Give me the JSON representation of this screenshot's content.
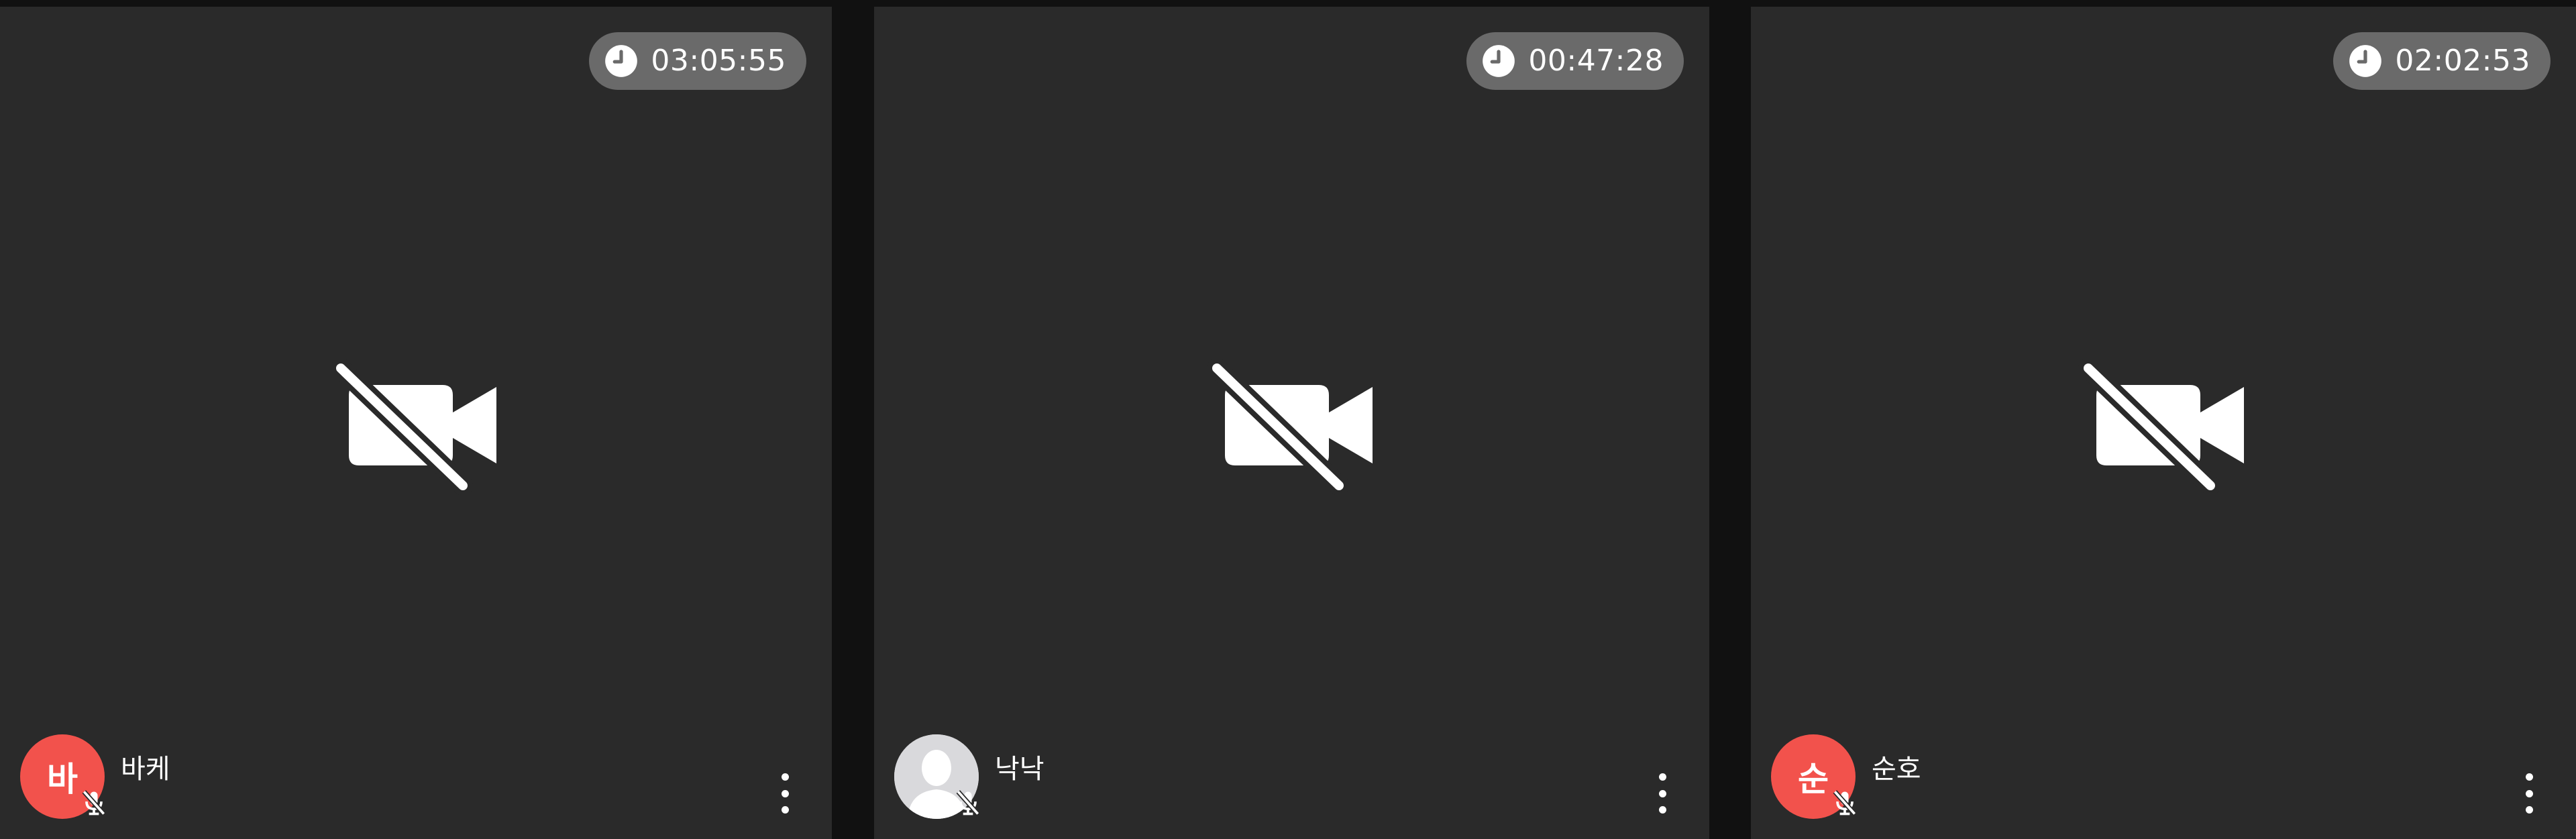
{
  "colors": {
    "page_background": "#111111",
    "tile_background": "#2a2a2a",
    "timer_pill": "#6a6a6a",
    "initials_avatar": "#f2524c",
    "photo_avatar": "#e4e4e6",
    "icon": "#ffffff"
  },
  "tiles": [
    {
      "timer": "03:05:55",
      "video_state_icon": "video-off-icon",
      "avatar": {
        "type": "initial",
        "initial": "바"
      },
      "name": "바케",
      "mic_state_icon": "mic-off-icon",
      "menu_icon": "more-vertical-icon"
    },
    {
      "timer": "00:47:28",
      "video_state_icon": "video-off-icon",
      "avatar": {
        "type": "default-photo",
        "initial": ""
      },
      "name": "낙낙",
      "mic_state_icon": "mic-off-icon",
      "menu_icon": "more-vertical-icon"
    },
    {
      "timer": "02:02:53",
      "video_state_icon": "video-off-icon",
      "avatar": {
        "type": "initial",
        "initial": "순"
      },
      "name": "순호",
      "mic_state_icon": "mic-off-icon",
      "menu_icon": "more-vertical-icon"
    }
  ]
}
